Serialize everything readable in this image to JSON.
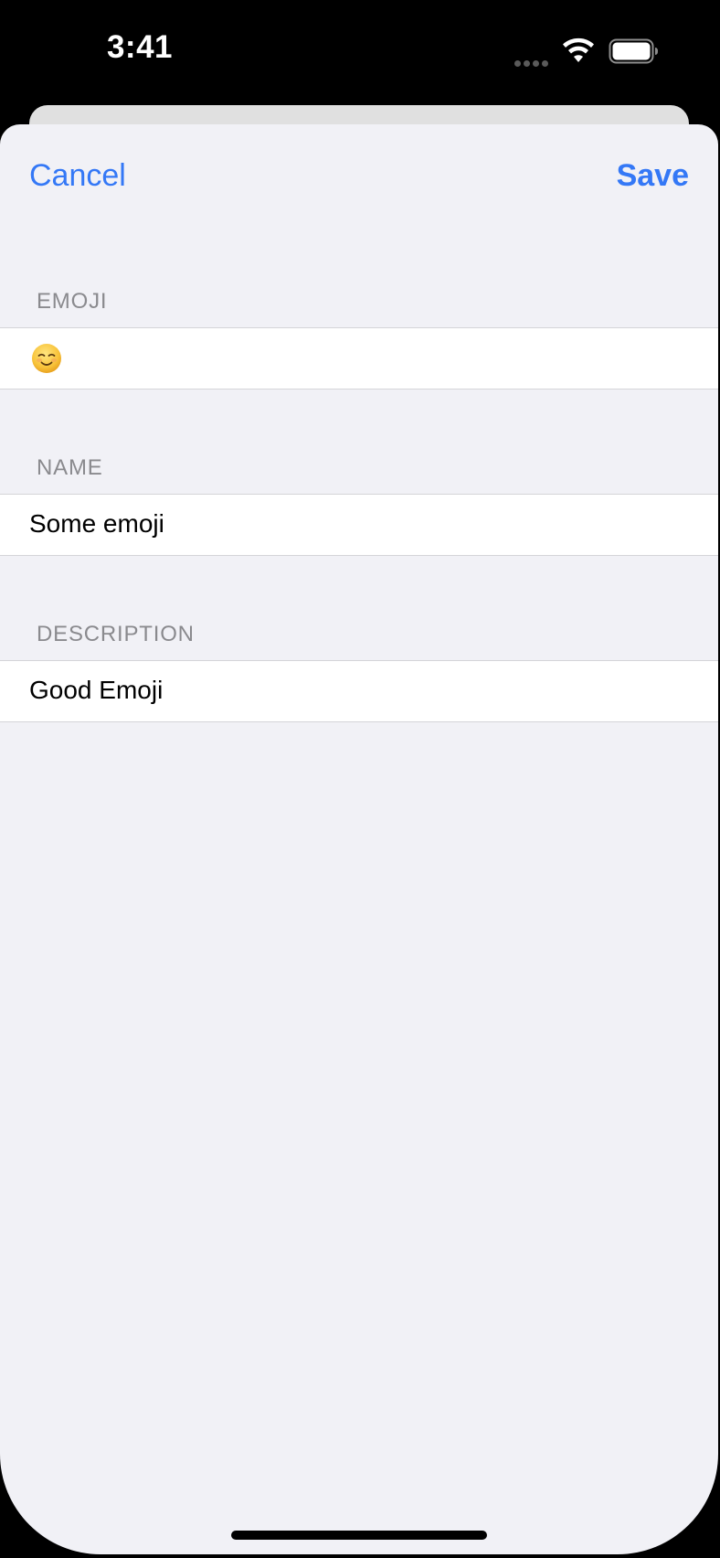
{
  "status_bar": {
    "time": "3:41",
    "icons": [
      "cellular-signal-icon",
      "wifi-icon",
      "battery-icon"
    ]
  },
  "nav": {
    "cancel_label": "Cancel",
    "save_label": "Save"
  },
  "sections": {
    "emoji": {
      "header": "EMOJI",
      "value": "☺️",
      "icon": "smiling-face-icon"
    },
    "name": {
      "header": "NAME",
      "value": "Some emoji"
    },
    "description": {
      "header": "DESCRIPTION",
      "value": "Good Emoji"
    }
  },
  "colors": {
    "accent": "#3478f6",
    "sheet_background": "#f1f1f6",
    "section_header": "#8a8a8e",
    "row_background": "#ffffff"
  }
}
